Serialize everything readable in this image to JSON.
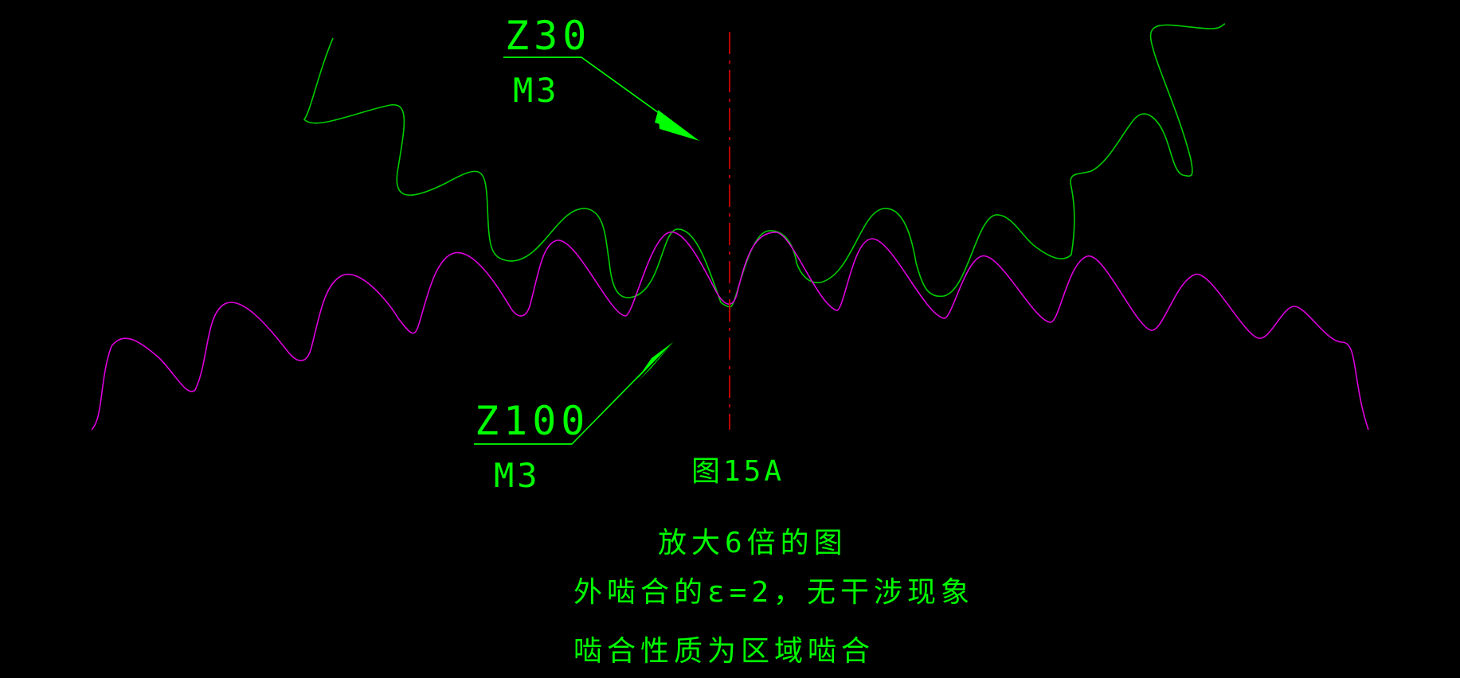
{
  "drawing": {
    "background_color": "#000000",
    "text_color": "#00ff00",
    "small_gear_color": "#00cc00",
    "large_gear_color": "#dd00dd",
    "centerline_color": "#cc0000",
    "arrow_color": "#00ff00"
  },
  "labels": {
    "small_gear": {
      "teeth": "Z30",
      "module": "M3"
    },
    "large_gear": {
      "teeth": "Z100",
      "module": "M3"
    },
    "figure_number": "图15A"
  },
  "captions": {
    "line1": "放大6倍的图",
    "line2": "外啮合的ε=2，无干涉现象",
    "line3": "啮合性质为区域啮合"
  }
}
